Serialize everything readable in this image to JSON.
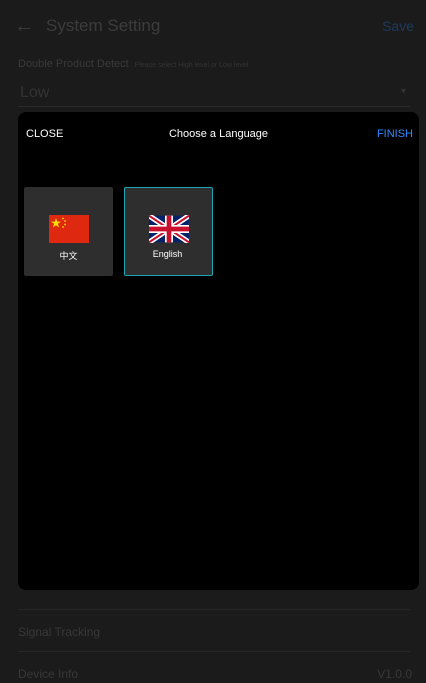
{
  "background": {
    "title": "System Setting",
    "save_label": "Save",
    "detect_label": "Double Product Detect",
    "detect_hint": "Please select High level or Low level",
    "detect_value": "Low",
    "signal_tracking": "Signal Tracking",
    "device_info": "Device Info",
    "version": "V1.0.0"
  },
  "modal": {
    "close_label": "CLOSE",
    "title": "Choose a Language",
    "finish_label": "FINISH",
    "accent_color": "#2f8cff",
    "selected_border_color": "#1aa6b7",
    "languages": [
      {
        "label": "中文",
        "flag": "china-flag-icon",
        "selected": false
      },
      {
        "label": "English",
        "flag": "uk-flag-icon",
        "selected": true
      }
    ]
  }
}
